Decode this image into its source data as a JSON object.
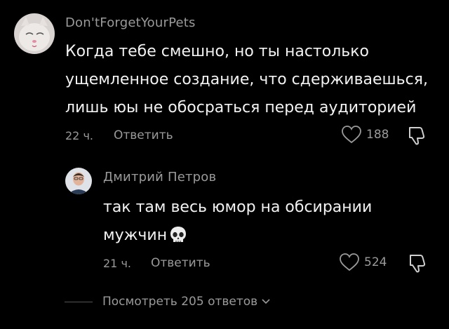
{
  "comments": [
    {
      "username": "Don'tForgetYourPets",
      "lines": [
        "Когда тебе смешно, но ты настолько",
        "ущемленное создание, что сдерживаешься,",
        "лишь юы не обосраться перед аудиторией"
      ],
      "time": "22 ч.",
      "reply_label": "Ответить",
      "likes": "188",
      "avatar_icon": "cat-avatar"
    },
    {
      "username": "Дмитрий Петров",
      "lines": [
        "так там весь юмор на обсирании",
        "мужчин"
      ],
      "emoji": "skull-emoji",
      "time": "21 ч.",
      "reply_label": "Ответить",
      "likes": "524",
      "avatar_icon": "man-avatar"
    }
  ],
  "view_replies_label": "Посмотреть 205 ответов",
  "colors": {
    "background": "#000000",
    "muted": "#9a9a9a",
    "text": "#f2f2f2"
  }
}
